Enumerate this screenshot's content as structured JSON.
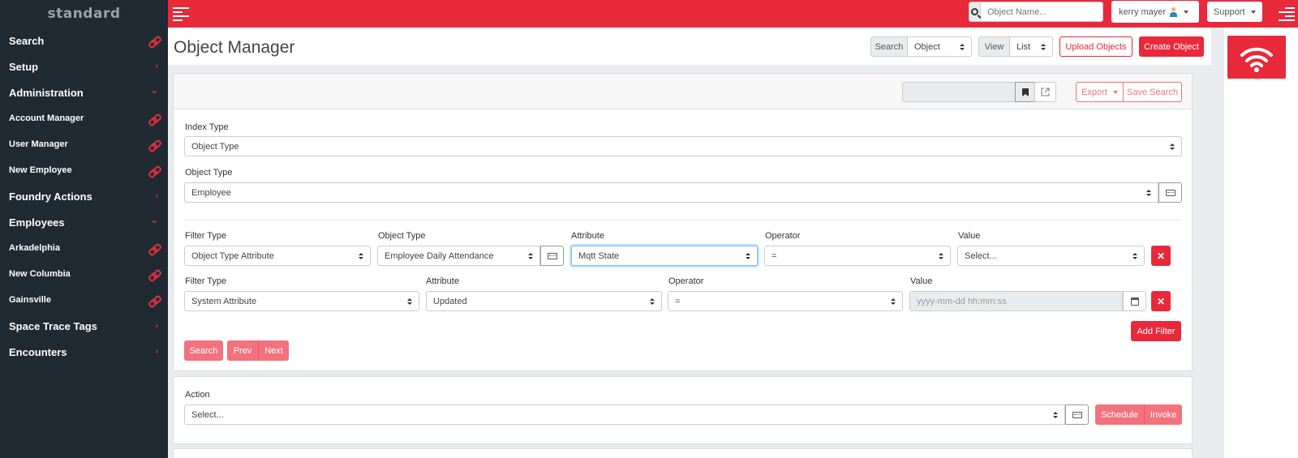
{
  "brand": {
    "logo_text": "standard"
  },
  "sidebar": {
    "items": [
      {
        "label": "Search",
        "level": "top",
        "icon": "link-icon"
      },
      {
        "label": "Setup",
        "level": "top",
        "icon": "chevron-right-icon"
      },
      {
        "label": "Administration",
        "level": "top",
        "icon": "chevron-down-icon"
      },
      {
        "label": "Account Manager",
        "level": "sub",
        "icon": "link-icon"
      },
      {
        "label": "User Manager",
        "level": "sub",
        "icon": "link-icon"
      },
      {
        "label": "New Employee",
        "level": "sub",
        "icon": "link-icon"
      },
      {
        "label": "Foundry Actions",
        "level": "top",
        "icon": "chevron-right-icon"
      },
      {
        "label": "Employees",
        "level": "top",
        "icon": "chevron-down-icon"
      },
      {
        "label": "Arkadelphia",
        "level": "sub",
        "icon": "link-icon"
      },
      {
        "label": "New Columbia",
        "level": "sub",
        "icon": "link-icon"
      },
      {
        "label": "Gainsville",
        "level": "sub",
        "icon": "link-icon"
      },
      {
        "label": "Space Trace Tags",
        "level": "top",
        "icon": "chevron-right-icon"
      },
      {
        "label": "Encounters",
        "level": "top",
        "icon": "chevron-right-icon"
      }
    ]
  },
  "topbar": {
    "search_placeholder": "Object Name...",
    "user_name": "kerry mayer",
    "support_label": "Support"
  },
  "header": {
    "title": "Object Manager",
    "search_label": "Search",
    "search_select": "Object",
    "view_label": "View",
    "view_select": "List",
    "upload_label": "Upload Objects",
    "create_label": "Create Object"
  },
  "card_head": {
    "export_label": "Export",
    "save_search_label": "Save Search"
  },
  "form": {
    "index_type_label": "Index Type",
    "index_type_value": "Object Type",
    "object_type_label": "Object Type",
    "object_type_value": "Employee",
    "filter1": {
      "filter_type_label": "Filter Type",
      "filter_type_value": "Object Type Attribute",
      "object_type_label": "Object Type",
      "object_type_value": "Employee Daily Attendance",
      "attribute_label": "Attribute",
      "attribute_value": "Mqtt State",
      "operator_label": "Operator",
      "operator_value": "=",
      "value_label": "Value",
      "value_value": "Select..."
    },
    "filter2": {
      "filter_type_label": "Filter Type",
      "filter_type_value": "System Attribute",
      "attribute_label": "Attribute",
      "attribute_value": "Updated",
      "operator_label": "Operator",
      "operator_value": "=",
      "value_label": "Value",
      "value_placeholder": "yyyy-mm-dd hh:mm:ss"
    },
    "add_filter_label": "Add Filter",
    "search_label": "Search",
    "prev_label": "Prev",
    "next_label": "Next",
    "remove_glyph": "✕"
  },
  "action": {
    "label": "Action",
    "value": "Select...",
    "schedule_label": "Schedule",
    "invoke_label": "Invoke"
  },
  "colors": {
    "brand_red": "#e8293a",
    "sidebar_bg": "#1f2a33",
    "pink_button": "#f2727d"
  }
}
